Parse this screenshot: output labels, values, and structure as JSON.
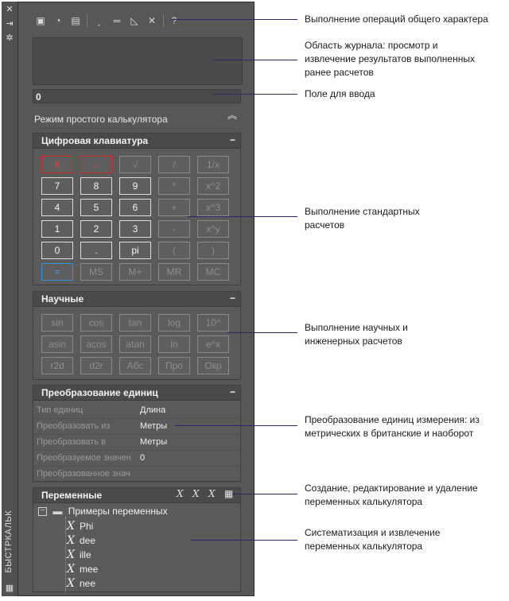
{
  "palette": {
    "title": "БЫСТРКАЛЬК",
    "strip_buttons": [
      "close-icon",
      "autohide-icon",
      "settings-icon"
    ],
    "toolbar": [
      "clear-icon",
      "clear-history-icon",
      "paste-icon",
      "get-coordinates-icon",
      "distance-icon",
      "angle-icon",
      "intersection-icon",
      "help-icon"
    ],
    "input_value": "0",
    "mode_label": "Режим простого калькулятора",
    "numpad": {
      "title": "Цифровая клавиатура",
      "keys": [
        [
          "К",
          "←",
          "√",
          "/",
          "1/x"
        ],
        [
          "7",
          "8",
          "9",
          "*",
          "x^2"
        ],
        [
          "4",
          "5",
          "6",
          "+",
          "x^3"
        ],
        [
          "1",
          "2",
          "3",
          "-",
          "x^y"
        ],
        [
          "0",
          ".",
          "pi",
          "(",
          ")"
        ],
        [
          "=",
          "MS",
          "M+",
          "MR",
          "MC"
        ]
      ]
    },
    "scientific": {
      "title": "Научные",
      "keys": [
        [
          "sin",
          "cos",
          "tan",
          "log",
          "10^"
        ],
        [
          "asin",
          "acos",
          "atan",
          "ln",
          "e^x"
        ],
        [
          "r2d",
          "d2r",
          "Абс",
          "Про",
          "Окр"
        ]
      ]
    },
    "units": {
      "title": "Преобразование единиц",
      "rows": [
        {
          "label": "Тип единиц",
          "value": "Длина"
        },
        {
          "label": "Преобразовать из",
          "value": "Метры"
        },
        {
          "label": "Преобразовать в",
          "value": "Метры"
        },
        {
          "label": "Преобразуемое значен",
          "value": "0"
        },
        {
          "label": "Преобразованное знач",
          "value": ""
        }
      ]
    },
    "variables": {
      "title": "Переменные",
      "tools": [
        "new-variable-icon",
        "edit-variable-icon",
        "delete-variable-icon",
        "calculator-icon"
      ],
      "group": "Примеры переменных",
      "items": [
        "Phi",
        "dee",
        "ille",
        "mee",
        "nee"
      ]
    }
  },
  "callouts": [
    "Выполнение операций общего характера",
    "Область журнала: просмотр и\nизвлечение результатов выполненных\nранее расчетов",
    "Поле для ввода",
    "Выполнение стандартных\nрасчетов",
    "Выполнение научных и\nинженерных расчетов",
    "Преобразование единиц измерения: из\nметрических в британские и наоборот",
    "Создание, редактирование и удаление\nпеременных калькулятора",
    "Систематизация и извлечение\nпеременных калькулятора"
  ]
}
